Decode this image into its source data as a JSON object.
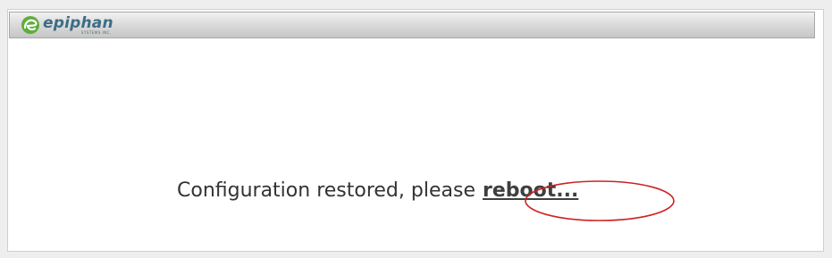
{
  "header": {
    "logo_word": "epiphan",
    "logo_subtext": "SYSTEMS INC.",
    "logo_icon": "epiphan-swirl-icon",
    "brand_color": "#3d6d86",
    "logo_green": "#5fae3b"
  },
  "main": {
    "message_text": "Configuration restored, please",
    "reboot_label": "reboot..."
  },
  "annotation": {
    "type": "highlight-ellipse",
    "color": "#cc2222"
  }
}
